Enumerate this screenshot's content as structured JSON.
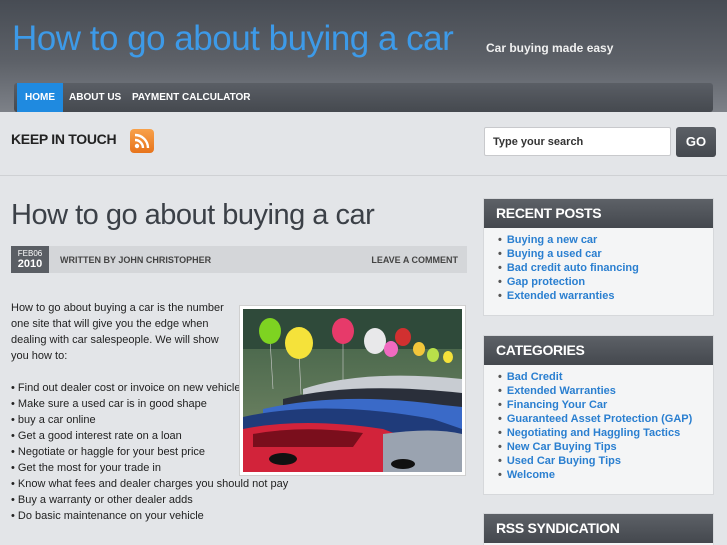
{
  "header": {
    "site_title": "How to go about buying a car",
    "tagline": "Car buying made easy"
  },
  "nav": {
    "items": [
      {
        "label": "HOME",
        "active": true
      },
      {
        "label": "ABOUT US",
        "active": false
      },
      {
        "label": "PAYMENT CALCULATOR",
        "active": false
      }
    ]
  },
  "social": {
    "keep_in_touch": "KEEP IN TOUCH",
    "rss_icon": "rss-feed-icon"
  },
  "search": {
    "placeholder": "Type your search",
    "button_label": "GO"
  },
  "post": {
    "title": "How to go about buying a car",
    "date_month_day": "FEB06",
    "date_year": "2010",
    "written_by": "WRITTEN BY JOHN CHRISTOPHER",
    "leave_comment": "LEAVE A COMMENT",
    "intro": "How to go about buying a car is the number one site that will give you the edge when dealing with car salespeople. We will show you how to:",
    "bullets": [
      "• Find out dealer cost or invoice on new vehicles",
      "• Make sure a used car is in good shape",
      "• buy a car online",
      "• Get a good interest rate on a loan",
      "• Negotiate or haggle for your best price",
      "• Get the most for your trade in",
      "• Know what fees and dealer charges you should not pay",
      "• Buy a warranty or other dealer adds",
      "• Do basic maintenance on your vehicle"
    ]
  },
  "sidebar": {
    "recent_posts": {
      "title": "RECENT POSTS",
      "items": [
        "Buying a new car",
        "Buying a used car",
        "Bad credit auto financing",
        "Gap protection",
        "Extended warranties"
      ]
    },
    "categories": {
      "title": "CATEGORIES",
      "items": [
        "Bad Credit",
        "Extended Warranties",
        "Financing Your Car",
        "Guaranteed Asset Protection (GAP)",
        "Negotiating and Haggling Tactics",
        "New Car Buying Tips",
        "Used Car Buying Tips",
        "Welcome"
      ]
    },
    "rss_syndication": {
      "title": "RSS SYNDICATION"
    }
  },
  "colors": {
    "accent": "#1f8ae0",
    "link": "#2a7fd0",
    "title_blue": "#3d9ae8",
    "header_dark": "#474c54"
  }
}
